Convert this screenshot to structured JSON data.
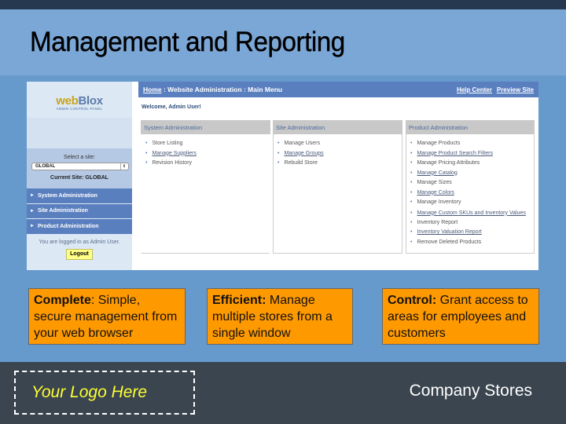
{
  "slide": {
    "title": "Management and Reporting"
  },
  "admin_panel": {
    "logo": {
      "web": "web",
      "blox": "Blox",
      "subtitle": "ADMIN CONTROL PANEL"
    },
    "select_site_label": "Select a site:",
    "site_select_value": "GLOBAL",
    "current_site": "Current Site: GLOBAL",
    "nav": [
      {
        "label": "System Administration"
      },
      {
        "label": "Site Administration"
      },
      {
        "label": "Product Administration"
      }
    ],
    "logged_in_text": "You are logged in as Admin User.",
    "logout_label": "Logout",
    "breadcrumb": {
      "home": "Home",
      "rest": " : Website Administration : Main Menu"
    },
    "header_links": {
      "help": "Help Center",
      "preview": "Preview Site"
    },
    "welcome": "Welcome, Admin User!",
    "panels": [
      {
        "title": "System Administration",
        "items": [
          {
            "label": "Store Listing",
            "link": false
          },
          {
            "label": "Manage Suppliers",
            "link": true
          },
          {
            "label": "Revision History",
            "link": false
          }
        ]
      },
      {
        "title": "Site Administration",
        "items": [
          {
            "label": "Manage Users",
            "link": false
          },
          {
            "label": "Manage Groups",
            "link": true
          },
          {
            "label": "Rebuild Store",
            "link": false
          }
        ]
      },
      {
        "title": "Product Administration",
        "items": [
          {
            "label": "Manage Products",
            "link": false
          },
          {
            "label": "Manage Product Search Filters",
            "link": true
          },
          {
            "label": "Manage Pricing Attributes",
            "link": false
          },
          {
            "label": "Manage Catalog",
            "link": true
          },
          {
            "label": "Manage Sizes",
            "link": false
          },
          {
            "label": "Manage Colors",
            "link": true
          },
          {
            "label": "Manage Inventory",
            "link": false
          },
          {
            "label": "Manage Custom SKUs and Inventory Values",
            "link": true
          },
          {
            "label": "Inventory Report",
            "link": false
          },
          {
            "label": "Inventory Valuation Report",
            "link": true
          },
          {
            "label": "Remove Deleted Products",
            "link": false
          }
        ]
      }
    ]
  },
  "features": [
    {
      "bold": "Complete",
      "text": ": Simple, secure management from your web browser"
    },
    {
      "bold": "Efficient:",
      "text": " Manage multiple stores from a single window"
    },
    {
      "bold": "Control:",
      "text": " Grant access to areas for employees and customers"
    }
  ],
  "footer": {
    "logo_placeholder": "Your Logo Here",
    "company": "Company Stores"
  },
  "colors": {
    "header_bg": "#7ba7d6",
    "body_bg": "#6699cc",
    "feature_bg": "#ff9900",
    "footer_bg": "#3a454f",
    "nav_blue": "#5a7fbf",
    "logo_yellow": "#ffff33"
  }
}
